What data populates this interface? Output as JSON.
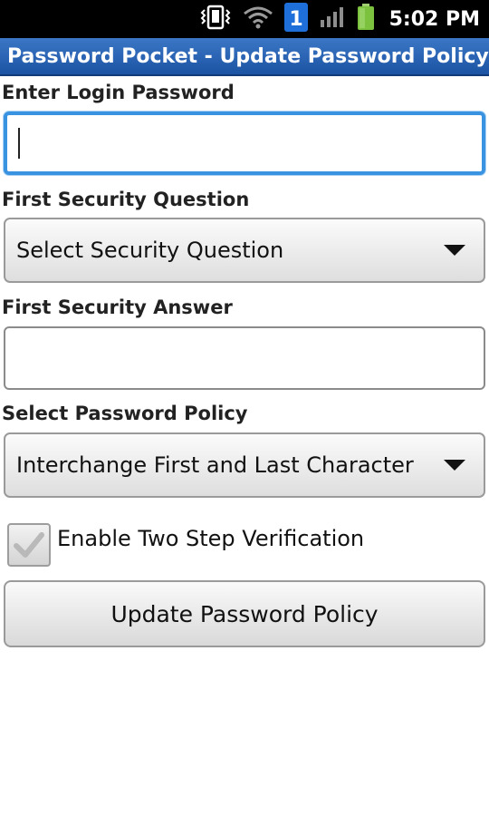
{
  "status_bar": {
    "time": "5:02 PM",
    "notification_badge": "1",
    "icons": [
      "vibrate-icon",
      "wifi-icon",
      "notification-badge",
      "signal-icon",
      "battery-icon"
    ]
  },
  "title_bar": {
    "title": "Password Pocket - Update Password Policy"
  },
  "form": {
    "login_password": {
      "label": "Enter Login Password",
      "value": ""
    },
    "first_security_question": {
      "label": "First Security Question",
      "selected": "Select Security Question"
    },
    "first_security_answer": {
      "label": "First Security Answer",
      "value": ""
    },
    "password_policy": {
      "label": "Select Password Policy",
      "selected": "Interchange First and Last Character"
    },
    "two_step": {
      "label": "Enable Two Step Verification",
      "checked": true
    },
    "submit_label": "Update Password Policy"
  },
  "colors": {
    "title_bar": "#1c53a3",
    "focus_border": "#3a93e0",
    "notification_badge": "#1e6fd9",
    "battery": "#7cc23e"
  }
}
